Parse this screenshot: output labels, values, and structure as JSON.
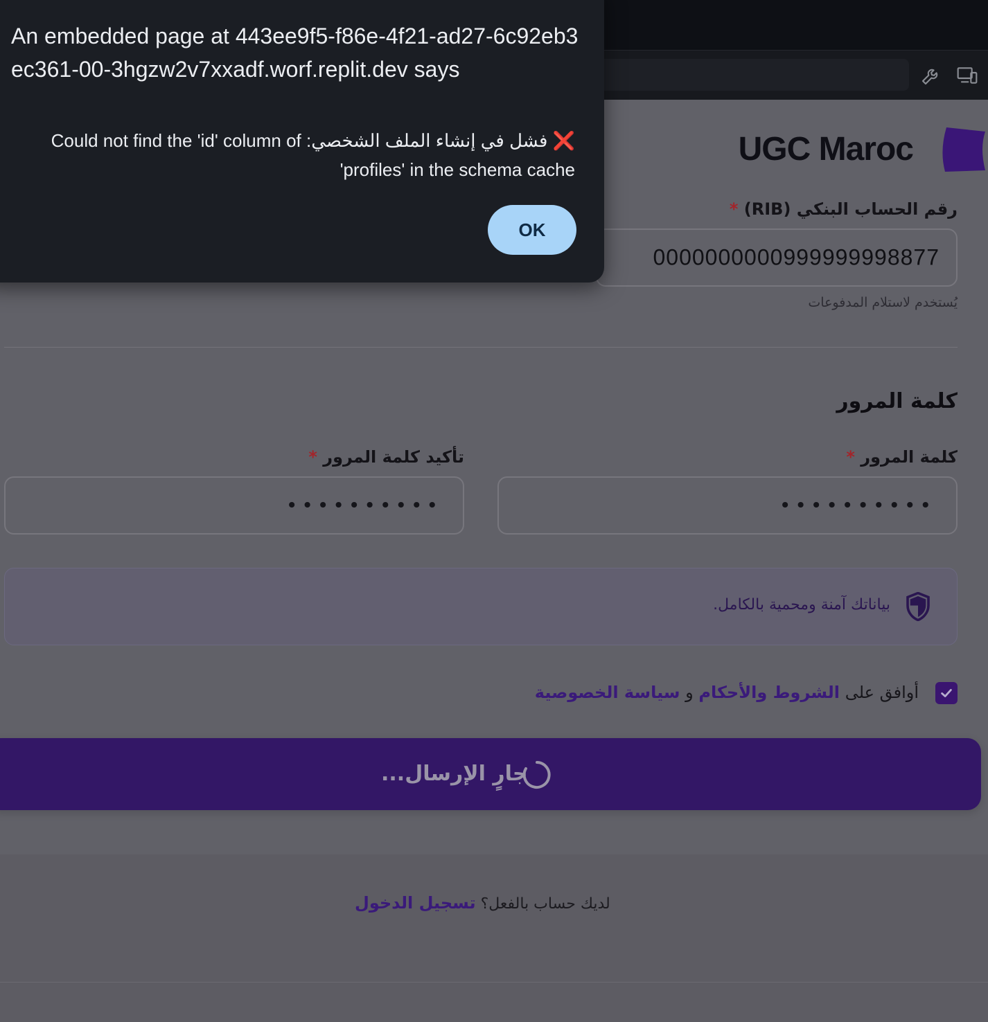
{
  "dialog": {
    "title": "An embedded page at 443ee9f5-f86e-4f21-ad27-6c92eb3ec361-00-3hgzw2v7xxadf.worf.replit.dev says",
    "message_icon": "❌",
    "message": "فشل في إنشاء الملف الشخصي: Could not find the 'id' column of 'profiles' in the schema cache",
    "ok_label": "OK"
  },
  "brand": {
    "name": "UGC Maroc"
  },
  "rib": {
    "label": "رقم الحساب البنكي (RIB)",
    "required_mark": "*",
    "value": "0000000000999999998877",
    "hint": "يُستخدم لاستلام المدفوعات"
  },
  "password_section": {
    "title": "كلمة المرور",
    "password_label": "كلمة المرور",
    "password_value": "••••••••••",
    "confirm_label": "تأكيد كلمة المرور",
    "confirm_value": "••••••••••",
    "required_mark": "*"
  },
  "secure_notice": {
    "text": "بياناتك آمنة ومحمية بالكامل."
  },
  "terms": {
    "prefix": "أوافق على",
    "terms_link": "الشروط والأحكام",
    "and": "و",
    "privacy_link": "سياسة الخصوصية",
    "checked": true
  },
  "submit": {
    "label": "جارٍ الإرسال..."
  },
  "login": {
    "prompt": "لديك حساب بالفعل؟",
    "link": "تسجيل الدخول"
  },
  "colors": {
    "accent": "#331766",
    "dialog_bg": "#1b1e24",
    "ok_button": "#a8d4f8"
  }
}
